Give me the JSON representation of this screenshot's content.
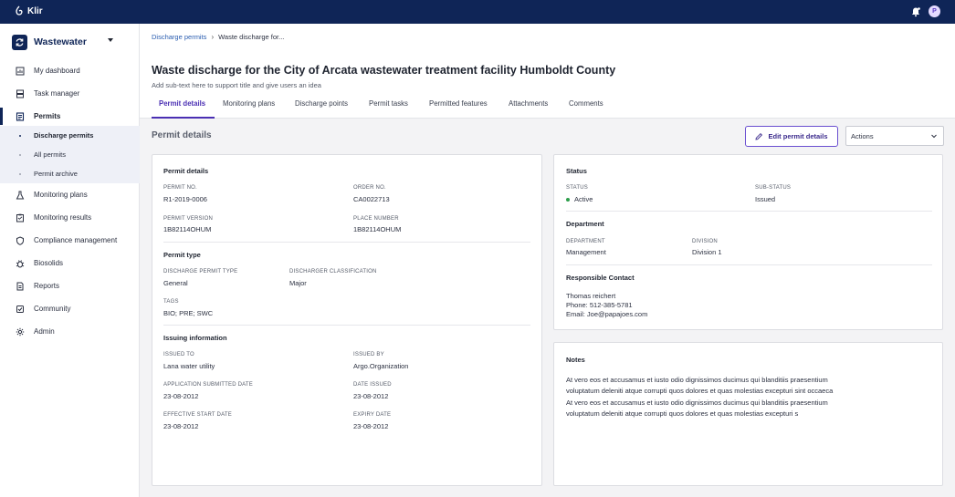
{
  "topbar": {
    "brand": "Klir",
    "avatar_initial": "P"
  },
  "sidebar": {
    "app_title": "Wastewater",
    "items": [
      {
        "label": "My dashboard",
        "icon": "dashboard-icon"
      },
      {
        "label": "Task manager",
        "icon": "tasks-icon"
      },
      {
        "label": "Permits",
        "icon": "permits-icon"
      },
      {
        "label": "Monitoring plans",
        "icon": "flask-icon"
      },
      {
        "label": "Monitoring results",
        "icon": "clipboard-icon"
      },
      {
        "label": "Compliance management",
        "icon": "shield-icon"
      },
      {
        "label": "Biosolids",
        "icon": "bug-icon"
      },
      {
        "label": "Reports",
        "icon": "report-icon"
      },
      {
        "label": "Community",
        "icon": "community-icon"
      },
      {
        "label": "Admin",
        "icon": "gear-icon"
      }
    ],
    "subitems": [
      {
        "label": "Discharge permits"
      },
      {
        "label": "All permits"
      },
      {
        "label": "Permit archive"
      }
    ]
  },
  "breadcrumb": {
    "link": "Discharge permits",
    "current": "Waste discharge for..."
  },
  "page": {
    "title": "Waste discharge for the City of Arcata wastewater treatment facility Humboldt County",
    "subtitle": "Add sub-text here to support title and give users an idea",
    "tabs": [
      "Permit details",
      "Monitoring plans",
      "Discharge points",
      "Permit tasks",
      "Permitted features",
      "Attachments",
      "Comments"
    ],
    "section_title": "Permit details",
    "edit_button": "Edit permit details",
    "actions_select": "Actions"
  },
  "details": {
    "permit_details_heading": "Permit details",
    "permit_no_label": "PERMIT NO.",
    "permit_no": "R1-2019-0006",
    "order_no_label": "ORDER NO.",
    "order_no": "CA0022713",
    "permit_version_label": "PERMIT VERSION",
    "permit_version": "1B82114OHUM",
    "place_number_label": "PLACE NUMBER",
    "place_number": "1B82114OHUM",
    "permit_type_heading": "Permit type",
    "discharge_type_label": "DISCHARGE PERMIT TYPE",
    "discharge_type": "General",
    "discharger_class_label": "DISCHARGER CLASSIFICATION",
    "discharger_class": "Major",
    "tags_label": "TAGS",
    "tags": "BIO; PRE; SWC",
    "issuing_heading": "Issuing information",
    "issued_to_label": "ISSUED TO",
    "issued_to": "Lana water utility",
    "issued_by_label": "ISSUED BY",
    "issued_by": "Argo.Organization",
    "app_submitted_label": "APPLICATION SUBMITTED DATE",
    "app_submitted": "23-08-2012",
    "date_issued_label": "DATE ISSUED",
    "date_issued": "23-08-2012",
    "effective_start_label": "EFFECTIVE START DATE",
    "effective_start": "23-08-2012",
    "expiry_label": "EXPIRY DATE",
    "expiry": "23-08-2012"
  },
  "status_card": {
    "status_heading": "Status",
    "status_label": "STATUS",
    "status": "Active",
    "substatus_label": "SUB-STATUS",
    "substatus": "Issued",
    "department_heading": "Department",
    "department_label": "DEPARTMENT",
    "department": "Management",
    "division_label": "DIVISION",
    "division": "Division 1",
    "contact_heading": "Responsible Contact",
    "contact_name": "Thomas reichert",
    "contact_phone": "Phone: 512-385-5781",
    "contact_email": "Email: Joe@papajoes.com",
    "status_color": "#2e9e4b"
  },
  "notes_card": {
    "heading": "Notes",
    "lines": [
      "At vero eos et accusamus et iusto odio dignissimos ducimus qui blanditiis praesentium",
      "voluptatum deleniti atque corrupti quos dolores et quas molestias excepturi sint occaeca",
      "At vero eos et accusamus et iusto odio dignissimos ducimus qui blanditiis praesentium",
      "voluptatum deleniti atque corrupti quos dolores et quas molestias excepturi s"
    ]
  },
  "colors": {
    "brand_navy": "#0f2557",
    "accent_purple": "#4a2fb3",
    "link_blue": "#2a5db0"
  }
}
